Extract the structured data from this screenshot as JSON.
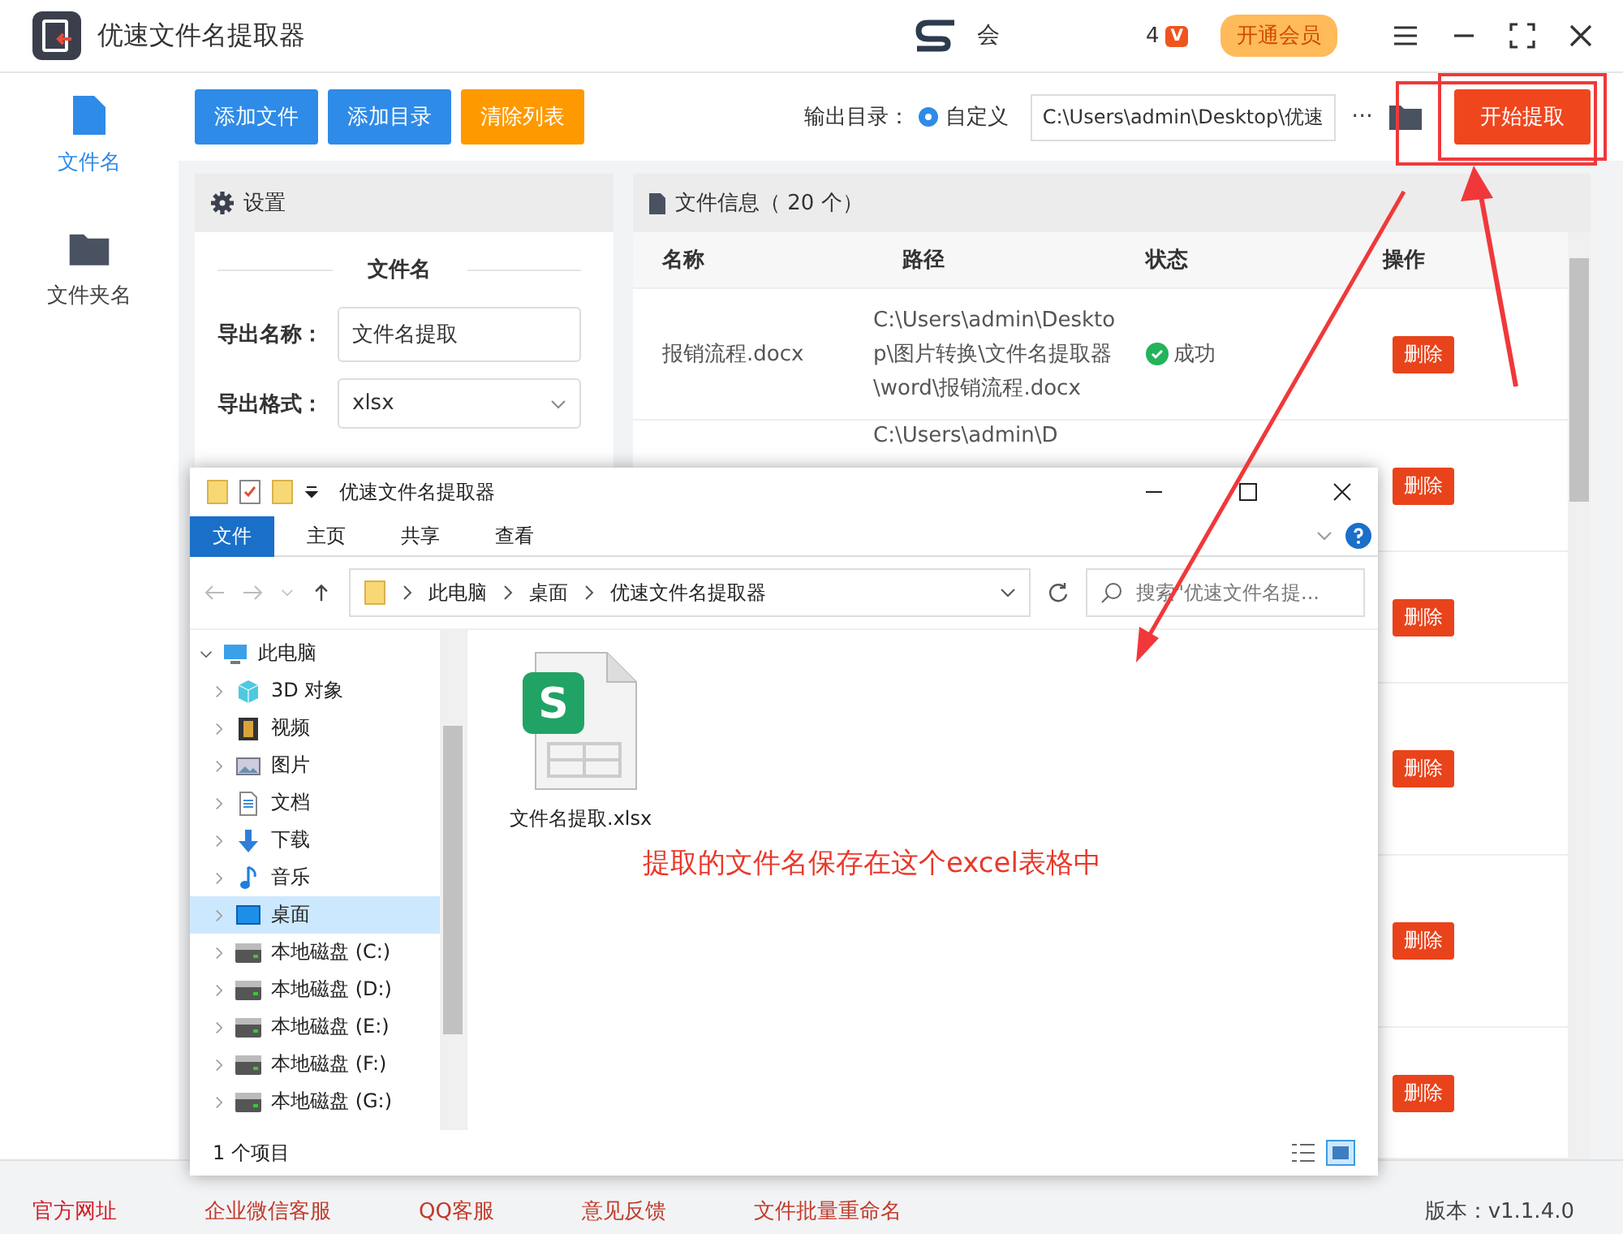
{
  "app": {
    "title": "优速文件名提取器",
    "member_text": "会",
    "vip_count": "4",
    "vip_badge": "V",
    "vip_button": "开通会员"
  },
  "side_tabs": [
    {
      "label": "文件名",
      "selected": true
    },
    {
      "label": "文件夹名",
      "selected": false
    }
  ],
  "toolbar": {
    "buttons": [
      {
        "label": "添加文件",
        "kind": "blue"
      },
      {
        "label": "添加目录",
        "kind": "blue"
      },
      {
        "label": "清除列表",
        "kind": "orange"
      }
    ],
    "output_label": "输出目录：",
    "radio": {
      "label": "自定义",
      "selected": true
    },
    "path": "C:\\Users\\admin\\Desktop\\优速",
    "more": "···",
    "start": "开始提取"
  },
  "settings": {
    "title": "设置",
    "section": "文件名",
    "fields": [
      {
        "label": "导出名称：",
        "kind": "input",
        "value": "文件名提取"
      },
      {
        "label": "导出格式：",
        "kind": "select",
        "value": "xlsx"
      }
    ]
  },
  "files": {
    "title": "文件信息（ 20 个）",
    "columns": [
      "名称",
      "路径",
      "状态",
      "操作"
    ],
    "rows": [
      {
        "name": "报销流程.docx",
        "path": "C:\\Users\\admin\\Desktop\\图片转换\\文件名提取器\\word\\报销流程.docx",
        "status": "成功",
        "action": "删除"
      },
      {
        "path": "C:\\Users\\admin\\D",
        "action": "删除"
      },
      {
        "action": "删除"
      },
      {
        "action": "删除"
      },
      {
        "action": "删除"
      },
      {
        "action": "删除"
      }
    ]
  },
  "explorer": {
    "title": "优速文件名提取器",
    "ribbon_tabs": [
      {
        "label": "文件",
        "selected": true
      },
      {
        "label": "主页",
        "selected": false
      },
      {
        "label": "共享",
        "selected": false
      },
      {
        "label": "查看",
        "selected": false
      }
    ],
    "breadcrumb": [
      "此电脑",
      "桌面",
      "优速文件名提取器"
    ],
    "search_placeholder": "搜索\"优速文件名提...",
    "tree": [
      {
        "label": "此电脑",
        "expanded": true,
        "selected": false,
        "children": [
          {
            "label": "3D 对象",
            "expanded": false,
            "selected": false
          },
          {
            "label": "视频",
            "expanded": false,
            "selected": false
          },
          {
            "label": "图片",
            "expanded": false,
            "selected": false
          },
          {
            "label": "文档",
            "expanded": false,
            "selected": false
          },
          {
            "label": "下载",
            "expanded": false,
            "selected": false
          },
          {
            "label": "音乐",
            "expanded": false,
            "selected": false
          },
          {
            "label": "桌面",
            "expanded": false,
            "selected": true
          },
          {
            "label": "本地磁盘 (C:)",
            "expanded": false,
            "selected": false
          },
          {
            "label": "本地磁盘 (D:)",
            "expanded": false,
            "selected": false
          },
          {
            "label": "本地磁盘 (E:)",
            "expanded": false,
            "selected": false
          },
          {
            "label": "本地磁盘 (F:)",
            "expanded": false,
            "selected": false
          },
          {
            "label": "本地磁盘 (G:)",
            "expanded": false,
            "selected": false
          }
        ]
      }
    ],
    "file": {
      "name": "文件名提取.xlsx",
      "badge": "S"
    },
    "status": "1 个项目"
  },
  "annotation": "提取的文件名保存在这个excel表格中",
  "footer": {
    "links": [
      "官方网址",
      "企业微信客服",
      "QQ客服",
      "意见反馈",
      "文件批量重命名"
    ],
    "version": "版本：v1.1.4.0"
  }
}
